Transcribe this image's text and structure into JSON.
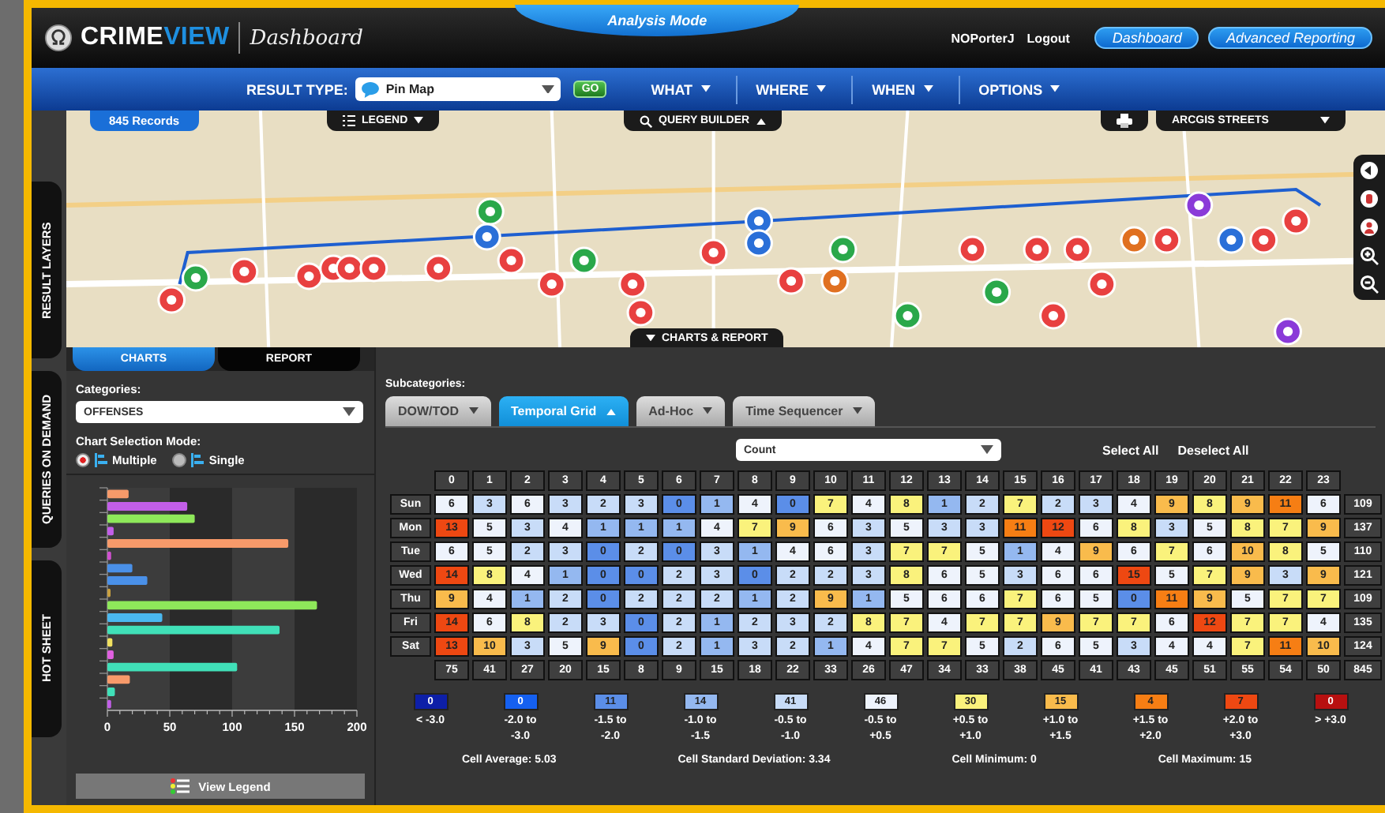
{
  "header": {
    "logo_text": {
      "plain": "CRIME",
      "accent": "VIEW"
    },
    "app_name": "Dashboard",
    "mode_tab": "Analysis Mode",
    "user": "NOPorterJ",
    "logout": "Logout",
    "buttons": [
      "Dashboard",
      "Advanced Reporting"
    ]
  },
  "nav": {
    "result_type_label": "RESULT TYPE:",
    "result_type": "Pin Map",
    "go": "GO",
    "menus": [
      "WHAT",
      "WHERE",
      "WHEN",
      "OPTIONS"
    ]
  },
  "map": {
    "records": "845 Records",
    "legend_button": "LEGEND",
    "query_builder": "QUERY BUILDER",
    "basemap": "ARCGIS STREETS",
    "bottom_tab": "CHARTS & REPORT"
  },
  "side_tabs": [
    "RESULT LAYERS",
    "QUERIES ON DEMAND",
    "HOT SHEET"
  ],
  "panel_tabs": [
    {
      "label": "CHARTS",
      "selected": true
    },
    {
      "label": "REPORT",
      "selected": false
    }
  ],
  "left_panel": {
    "categories_label": "Categories:",
    "category": "OFFENSES",
    "mode_label": "Chart Selection Mode:",
    "modes": [
      {
        "label": "Multiple",
        "selected": true
      },
      {
        "label": "Single",
        "selected": false
      }
    ],
    "chart_data": {
      "type": "bar",
      "orientation": "horizontal",
      "xlim": [
        0,
        200
      ],
      "xticks": [
        0,
        50,
        100,
        150,
        200
      ],
      "values": [
        17,
        64,
        70,
        5,
        145,
        3,
        20,
        32,
        1,
        168,
        44,
        138,
        4,
        5,
        104,
        18,
        6,
        3
      ]
    },
    "view_legend": "View Legend"
  },
  "subcategories_label": "Subcategories:",
  "sub_tabs": [
    {
      "label": "DOW/TOD",
      "selected": false
    },
    {
      "label": "Temporal Grid",
      "selected": true
    },
    {
      "label": "Ad-Hoc",
      "selected": false
    },
    {
      "label": "Time Sequencer",
      "selected": false
    }
  ],
  "measure": "Count",
  "select_all": "Select All",
  "deselect_all": "Deselect All",
  "grid": {
    "columns": [
      "0",
      "1",
      "2",
      "3",
      "4",
      "5",
      "6",
      "7",
      "8",
      "9",
      "10",
      "11",
      "12",
      "13",
      "14",
      "15",
      "16",
      "17",
      "18",
      "19",
      "20",
      "21",
      "22",
      "23"
    ],
    "rows": [
      {
        "day": "Sun",
        "total": "109",
        "cells": [
          {
            "v": "6",
            "color": "#eef3fc"
          },
          {
            "v": "3",
            "color": "#c8dcf8"
          },
          {
            "v": "6",
            "color": "#eef3fc"
          },
          {
            "v": "3",
            "color": "#c8dcf8"
          },
          {
            "v": "2",
            "color": "#c8dcf8"
          },
          {
            "v": "3",
            "color": "#c8dcf8"
          },
          {
            "v": "0",
            "color": "#5b8ee8"
          },
          {
            "v": "1",
            "color": "#94b8f0"
          },
          {
            "v": "4",
            "color": "#eef3fc"
          },
          {
            "v": "0",
            "color": "#5b8ee8"
          },
          {
            "v": "7",
            "color": "#faf27c"
          },
          {
            "v": "4",
            "color": "#eef3fc"
          },
          {
            "v": "8",
            "color": "#faf27c"
          },
          {
            "v": "1",
            "color": "#94b8f0"
          },
          {
            "v": "2",
            "color": "#c8dcf8"
          },
          {
            "v": "7",
            "color": "#faf27c"
          },
          {
            "v": "2",
            "color": "#c8dcf8"
          },
          {
            "v": "3",
            "color": "#c8dcf8"
          },
          {
            "v": "4",
            "color": "#eef3fc"
          },
          {
            "v": "9",
            "color": "#f9bb4c"
          },
          {
            "v": "8",
            "color": "#faf27c"
          },
          {
            "v": "9",
            "color": "#f9bb4c"
          },
          {
            "v": "11",
            "color": "#f67e14"
          },
          {
            "v": "6",
            "color": "#eef3fc"
          }
        ]
      },
      {
        "day": "Mon",
        "total": "137",
        "cells": [
          {
            "v": "13",
            "color": "#ee4812"
          },
          {
            "v": "5",
            "color": "#eef3fc"
          },
          {
            "v": "3",
            "color": "#c8dcf8"
          },
          {
            "v": "4",
            "color": "#eef3fc"
          },
          {
            "v": "1",
            "color": "#94b8f0"
          },
          {
            "v": "1",
            "color": "#94b8f0"
          },
          {
            "v": "1",
            "color": "#94b8f0"
          },
          {
            "v": "4",
            "color": "#eef3fc"
          },
          {
            "v": "7",
            "color": "#faf27c"
          },
          {
            "v": "9",
            "color": "#f9bb4c"
          },
          {
            "v": "6",
            "color": "#eef3fc"
          },
          {
            "v": "3",
            "color": "#c8dcf8"
          },
          {
            "v": "5",
            "color": "#eef3fc"
          },
          {
            "v": "3",
            "color": "#c8dcf8"
          },
          {
            "v": "3",
            "color": "#c8dcf8"
          },
          {
            "v": "11",
            "color": "#f67e14"
          },
          {
            "v": "12",
            "color": "#ee4812"
          },
          {
            "v": "6",
            "color": "#eef3fc"
          },
          {
            "v": "8",
            "color": "#faf27c"
          },
          {
            "v": "3",
            "color": "#c8dcf8"
          },
          {
            "v": "5",
            "color": "#eef3fc"
          },
          {
            "v": "8",
            "color": "#faf27c"
          },
          {
            "v": "7",
            "color": "#faf27c"
          },
          {
            "v": "9",
            "color": "#f9bb4c"
          }
        ]
      },
      {
        "day": "Tue",
        "total": "110",
        "cells": [
          {
            "v": "6",
            "color": "#eef3fc"
          },
          {
            "v": "5",
            "color": "#eef3fc"
          },
          {
            "v": "2",
            "color": "#c8dcf8"
          },
          {
            "v": "3",
            "color": "#c8dcf8"
          },
          {
            "v": "0",
            "color": "#5b8ee8"
          },
          {
            "v": "2",
            "color": "#c8dcf8"
          },
          {
            "v": "0",
            "color": "#5b8ee8"
          },
          {
            "v": "3",
            "color": "#c8dcf8"
          },
          {
            "v": "1",
            "color": "#94b8f0"
          },
          {
            "v": "4",
            "color": "#eef3fc"
          },
          {
            "v": "6",
            "color": "#eef3fc"
          },
          {
            "v": "3",
            "color": "#c8dcf8"
          },
          {
            "v": "7",
            "color": "#faf27c"
          },
          {
            "v": "7",
            "color": "#faf27c"
          },
          {
            "v": "5",
            "color": "#eef3fc"
          },
          {
            "v": "1",
            "color": "#94b8f0"
          },
          {
            "v": "4",
            "color": "#eef3fc"
          },
          {
            "v": "9",
            "color": "#f9bb4c"
          },
          {
            "v": "6",
            "color": "#eef3fc"
          },
          {
            "v": "7",
            "color": "#faf27c"
          },
          {
            "v": "6",
            "color": "#eef3fc"
          },
          {
            "v": "10",
            "color": "#f9bb4c"
          },
          {
            "v": "8",
            "color": "#faf27c"
          },
          {
            "v": "5",
            "color": "#eef3fc"
          }
        ]
      },
      {
        "day": "Wed",
        "total": "121",
        "cells": [
          {
            "v": "14",
            "color": "#ee4812"
          },
          {
            "v": "8",
            "color": "#faf27c"
          },
          {
            "v": "4",
            "color": "#eef3fc"
          },
          {
            "v": "1",
            "color": "#94b8f0"
          },
          {
            "v": "0",
            "color": "#5b8ee8"
          },
          {
            "v": "0",
            "color": "#5b8ee8"
          },
          {
            "v": "2",
            "color": "#c8dcf8"
          },
          {
            "v": "3",
            "color": "#c8dcf8"
          },
          {
            "v": "0",
            "color": "#5b8ee8"
          },
          {
            "v": "2",
            "color": "#c8dcf8"
          },
          {
            "v": "2",
            "color": "#c8dcf8"
          },
          {
            "v": "3",
            "color": "#c8dcf8"
          },
          {
            "v": "8",
            "color": "#faf27c"
          },
          {
            "v": "6",
            "color": "#eef3fc"
          },
          {
            "v": "5",
            "color": "#eef3fc"
          },
          {
            "v": "3",
            "color": "#c8dcf8"
          },
          {
            "v": "6",
            "color": "#eef3fc"
          },
          {
            "v": "6",
            "color": "#eef3fc"
          },
          {
            "v": "15",
            "color": "#ee4812"
          },
          {
            "v": "5",
            "color": "#eef3fc"
          },
          {
            "v": "7",
            "color": "#faf27c"
          },
          {
            "v": "9",
            "color": "#f9bb4c"
          },
          {
            "v": "3",
            "color": "#c8dcf8"
          },
          {
            "v": "9",
            "color": "#f9bb4c"
          }
        ]
      },
      {
        "day": "Thu",
        "total": "109",
        "cells": [
          {
            "v": "9",
            "color": "#f9bb4c"
          },
          {
            "v": "4",
            "color": "#eef3fc"
          },
          {
            "v": "1",
            "color": "#94b8f0"
          },
          {
            "v": "2",
            "color": "#c8dcf8"
          },
          {
            "v": "0",
            "color": "#5b8ee8"
          },
          {
            "v": "2",
            "color": "#c8dcf8"
          },
          {
            "v": "2",
            "color": "#c8dcf8"
          },
          {
            "v": "2",
            "color": "#c8dcf8"
          },
          {
            "v": "1",
            "color": "#94b8f0"
          },
          {
            "v": "2",
            "color": "#c8dcf8"
          },
          {
            "v": "9",
            "color": "#f9bb4c"
          },
          {
            "v": "1",
            "color": "#94b8f0"
          },
          {
            "v": "5",
            "color": "#eef3fc"
          },
          {
            "v": "6",
            "color": "#eef3fc"
          },
          {
            "v": "6",
            "color": "#eef3fc"
          },
          {
            "v": "7",
            "color": "#faf27c"
          },
          {
            "v": "6",
            "color": "#eef3fc"
          },
          {
            "v": "5",
            "color": "#eef3fc"
          },
          {
            "v": "0",
            "color": "#5b8ee8"
          },
          {
            "v": "11",
            "color": "#f67e14"
          },
          {
            "v": "9",
            "color": "#f9bb4c"
          },
          {
            "v": "5",
            "color": "#eef3fc"
          },
          {
            "v": "7",
            "color": "#faf27c"
          },
          {
            "v": "7",
            "color": "#faf27c"
          }
        ]
      },
      {
        "day": "Fri",
        "total": "135",
        "cells": [
          {
            "v": "14",
            "color": "#ee4812"
          },
          {
            "v": "6",
            "color": "#eef3fc"
          },
          {
            "v": "8",
            "color": "#faf27c"
          },
          {
            "v": "2",
            "color": "#c8dcf8"
          },
          {
            "v": "3",
            "color": "#c8dcf8"
          },
          {
            "v": "0",
            "color": "#5b8ee8"
          },
          {
            "v": "2",
            "color": "#c8dcf8"
          },
          {
            "v": "1",
            "color": "#94b8f0"
          },
          {
            "v": "2",
            "color": "#c8dcf8"
          },
          {
            "v": "3",
            "color": "#c8dcf8"
          },
          {
            "v": "2",
            "color": "#c8dcf8"
          },
          {
            "v": "8",
            "color": "#faf27c"
          },
          {
            "v": "7",
            "color": "#faf27c"
          },
          {
            "v": "4",
            "color": "#eef3fc"
          },
          {
            "v": "7",
            "color": "#faf27c"
          },
          {
            "v": "7",
            "color": "#faf27c"
          },
          {
            "v": "9",
            "color": "#f9bb4c"
          },
          {
            "v": "7",
            "color": "#faf27c"
          },
          {
            "v": "7",
            "color": "#faf27c"
          },
          {
            "v": "6",
            "color": "#eef3fc"
          },
          {
            "v": "12",
            "color": "#ee4812"
          },
          {
            "v": "7",
            "color": "#faf27c"
          },
          {
            "v": "7",
            "color": "#faf27c"
          },
          {
            "v": "4",
            "color": "#eef3fc"
          }
        ]
      },
      {
        "day": "Sat",
        "total": "124",
        "cells": [
          {
            "v": "13",
            "color": "#ee4812"
          },
          {
            "v": "10",
            "color": "#f9bb4c"
          },
          {
            "v": "3",
            "color": "#c8dcf8"
          },
          {
            "v": "5",
            "color": "#eef3fc"
          },
          {
            "v": "9",
            "color": "#f9bb4c"
          },
          {
            "v": "0",
            "color": "#5b8ee8"
          },
          {
            "v": "2",
            "color": "#c8dcf8"
          },
          {
            "v": "1",
            "color": "#94b8f0"
          },
          {
            "v": "3",
            "color": "#c8dcf8"
          },
          {
            "v": "2",
            "color": "#c8dcf8"
          },
          {
            "v": "1",
            "color": "#94b8f0"
          },
          {
            "v": "4",
            "color": "#eef3fc"
          },
          {
            "v": "7",
            "color": "#faf27c"
          },
          {
            "v": "7",
            "color": "#faf27c"
          },
          {
            "v": "5",
            "color": "#eef3fc"
          },
          {
            "v": "2",
            "color": "#c8dcf8"
          },
          {
            "v": "6",
            "color": "#eef3fc"
          },
          {
            "v": "5",
            "color": "#eef3fc"
          },
          {
            "v": "3",
            "color": "#c8dcf8"
          },
          {
            "v": "4",
            "color": "#eef3fc"
          },
          {
            "v": "4",
            "color": "#eef3fc"
          },
          {
            "v": "7",
            "color": "#faf27c"
          },
          {
            "v": "11",
            "color": "#f67e14"
          },
          {
            "v": "10",
            "color": "#f9bb4c"
          }
        ]
      }
    ],
    "totals": [
      "75",
      "41",
      "27",
      "20",
      "15",
      "8",
      "9",
      "15",
      "18",
      "22",
      "33",
      "26",
      "47",
      "34",
      "33",
      "38",
      "45",
      "41",
      "43",
      "45",
      "51",
      "55",
      "54",
      "50"
    ],
    "grand_total": "845"
  },
  "legend": [
    {
      "count": "0",
      "lines": [
        "< -3.0"
      ],
      "color": "#0d1fa8"
    },
    {
      "count": "0",
      "lines": [
        "-2.0 to",
        "-3.0"
      ],
      "color": "#1560f0"
    },
    {
      "count": "11",
      "lines": [
        "-1.5 to",
        "-2.0"
      ],
      "color": "#5b8ee8"
    },
    {
      "count": "14",
      "lines": [
        "-1.0 to",
        "-1.5"
      ],
      "color": "#94b8f0"
    },
    {
      "count": "41",
      "lines": [
        "-0.5 to",
        "-1.0"
      ],
      "color": "#c8dcf8"
    },
    {
      "count": "46",
      "lines": [
        "-0.5 to",
        "+0.5"
      ],
      "color": "#eef3fc"
    },
    {
      "count": "30",
      "lines": [
        "+0.5 to",
        "+1.0"
      ],
      "color": "#faf27c"
    },
    {
      "count": "15",
      "lines": [
        "+1.0 to",
        "+1.5"
      ],
      "color": "#f9bb4c"
    },
    {
      "count": "4",
      "lines": [
        "+1.5 to",
        "+2.0"
      ],
      "color": "#f67e14"
    },
    {
      "count": "7",
      "lines": [
        "+2.0 to",
        "+3.0"
      ],
      "color": "#ee4812"
    },
    {
      "count": "0",
      "lines": [
        "> +3.0"
      ],
      "color": "#b81010"
    }
  ],
  "stats": [
    "Cell Average: 5.03",
    "Cell Standard Deviation: 3.34",
    "Cell Minimum: 0",
    "Cell Maximum: 15"
  ]
}
